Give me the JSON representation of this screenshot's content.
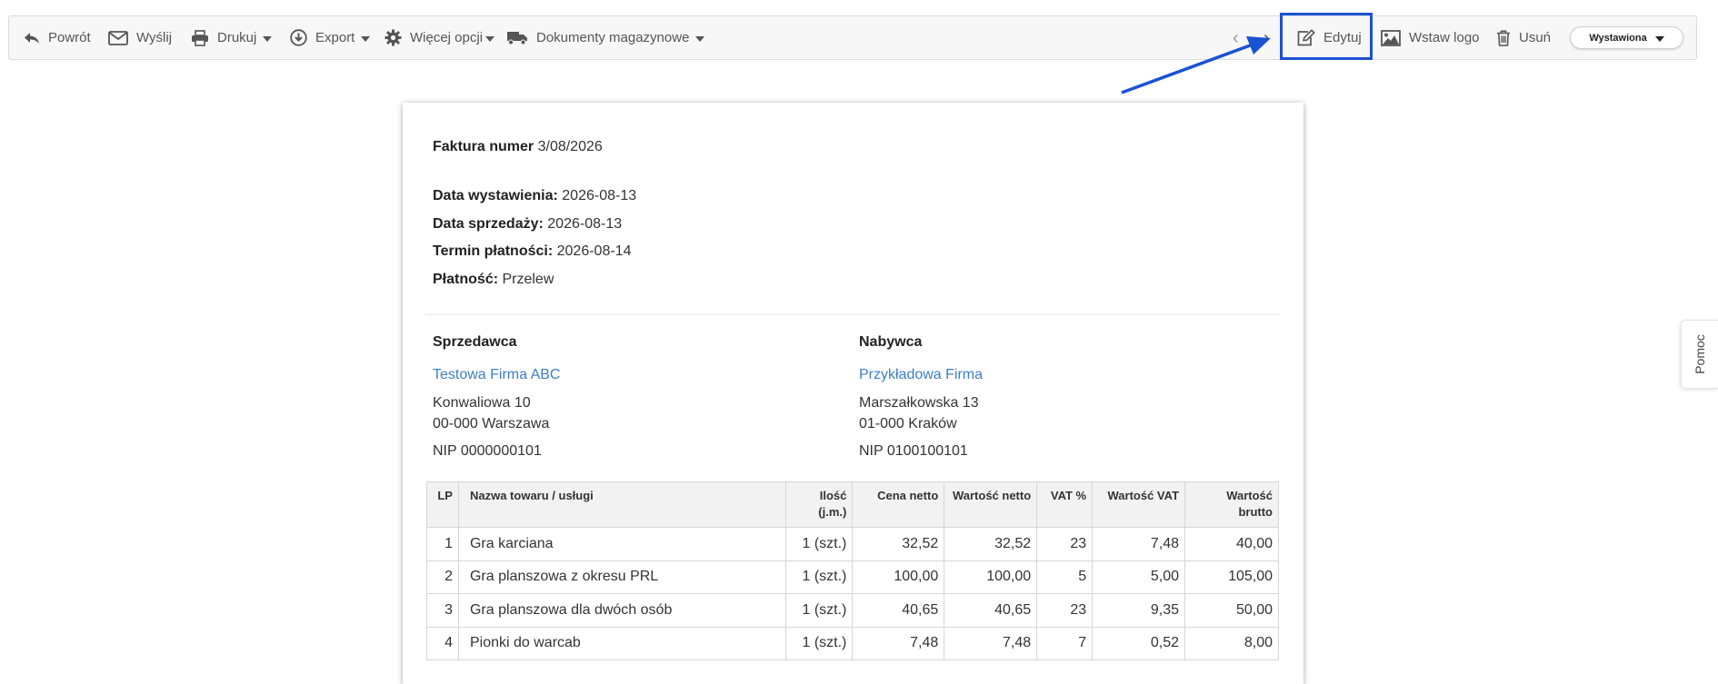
{
  "toolbar": {
    "back": "Powrót",
    "send": "Wyślij",
    "print": "Drukuj",
    "export": "Export",
    "more": "Więcej opcji",
    "warehouse": "Dokumenty magazynowe",
    "edit": "Edytuj",
    "insert_logo": "Wstaw logo",
    "delete": "Usuń",
    "status": "Wystawiona"
  },
  "help_tab": "Pomoc",
  "invoice": {
    "number_label": "Faktura numer",
    "number": "3/08/2026",
    "issue_date_label": "Data wystawienia:",
    "issue_date": "2026-08-13",
    "sale_date_label": "Data sprzedaży:",
    "sale_date": "2026-08-13",
    "due_date_label": "Termin płatności:",
    "due_date": "2026-08-14",
    "payment_label": "Płatność:",
    "payment": "Przelew",
    "seller": {
      "heading": "Sprzedawca",
      "name": "Testowa Firma ABC",
      "street": "Konwaliowa 10",
      "city": "00-000 Warszawa",
      "nip": "NIP 0000000101"
    },
    "buyer": {
      "heading": "Nabywca",
      "name": "Przykładowa Firma",
      "street": "Marszałkowska 13",
      "city": "01-000 Kraków",
      "nip": "NIP 0100100101"
    },
    "table": {
      "headers": {
        "lp": "LP",
        "name": "Nazwa towaru / usługi",
        "qty_1": "Ilość",
        "qty_2": "(j.m.)",
        "net_price": "Cena netto",
        "net_value": "Wartość netto",
        "vat_rate": "VAT %",
        "vat_value": "Wartość VAT",
        "gross_1": "Wartość",
        "gross_2": "brutto"
      },
      "rows": [
        {
          "lp": "1",
          "name": "Gra karciana",
          "qty": "1 (szt.)",
          "net_price": "32,52",
          "net_value": "32,52",
          "vat_rate": "23",
          "vat_value": "7,48",
          "gross": "40,00"
        },
        {
          "lp": "2",
          "name": "Gra planszowa z okresu PRL",
          "qty": "1 (szt.)",
          "net_price": "100,00",
          "net_value": "100,00",
          "vat_rate": "5",
          "vat_value": "5,00",
          "gross": "105,00"
        },
        {
          "lp": "3",
          "name": "Gra planszowa dla dwóch osób",
          "qty": "1 (szt.)",
          "net_price": "40,65",
          "net_value": "40,65",
          "vat_rate": "23",
          "vat_value": "9,35",
          "gross": "50,00"
        },
        {
          "lp": "4",
          "name": "Pionki do warcab",
          "qty": "1 (szt.)",
          "net_price": "7,48",
          "net_value": "7,48",
          "vat_rate": "7",
          "vat_value": "0,52",
          "gross": "8,00"
        }
      ]
    }
  },
  "colors": {
    "accent_link": "#3c7fc2",
    "highlight": "#1a52d4"
  }
}
